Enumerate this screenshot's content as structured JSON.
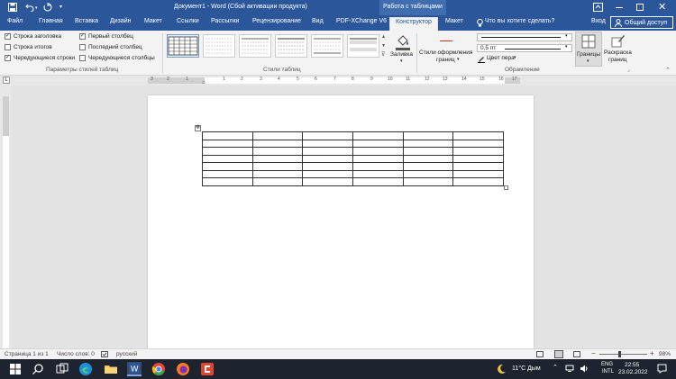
{
  "title_bar": {
    "document_title": "Документ1 - Word (Сбой активации продукта)",
    "context_title": "Работа с таблицами",
    "account": "Вход"
  },
  "ribbon_tabs": [
    {
      "label": "Файл"
    },
    {
      "label": "Главная"
    },
    {
      "label": "Вставка"
    },
    {
      "label": "Дизайн"
    },
    {
      "label": "Макет"
    },
    {
      "label": "Ссылки"
    },
    {
      "label": "Рассылки"
    },
    {
      "label": "Рецензирование"
    },
    {
      "label": "Вид"
    },
    {
      "label": "PDF-XChange V6"
    },
    {
      "label": "Конструктор"
    },
    {
      "label": "Макет"
    }
  ],
  "tell_me": "Что вы хотите сделать?",
  "share": "Общий доступ",
  "table_style_options": {
    "group_label": "Параметры стилей таблиц",
    "options": [
      {
        "label": "Строка заголовка",
        "checked": true
      },
      {
        "label": "Строка итогов",
        "checked": false
      },
      {
        "label": "Чередующиеся строки",
        "checked": true
      },
      {
        "label": "Первый столбец",
        "checked": true
      },
      {
        "label": "Последний столбец",
        "checked": false
      },
      {
        "label": "Чередующиеся столбцы",
        "checked": false
      }
    ]
  },
  "table_styles": {
    "group_label": "Стили таблиц"
  },
  "shading": {
    "label": "Заливка"
  },
  "borders_group": {
    "group_label": "Обрамление",
    "border_styles_line1": "Стили оформления",
    "border_styles_line2": "границ",
    "weight": "0,5 пт",
    "pen_color": "Цвет пера",
    "borders_label": "Границы",
    "painter_line1": "Раскраска",
    "painter_line2": "границ"
  },
  "ruler_numbers": [
    "3",
    "2",
    "1",
    "1",
    "2",
    "3",
    "4",
    "5",
    "6",
    "7",
    "8",
    "9",
    "10",
    "11",
    "12",
    "13",
    "14",
    "15",
    "16",
    "17"
  ],
  "document_table": {
    "rows": 7,
    "cols": 6
  },
  "status_bar": {
    "page": "Страница 1 из 1",
    "words": "Число слов: 0",
    "language": "русский",
    "zoom": "98%"
  },
  "taskbar": {
    "weather": "11°C Дым",
    "lang_line1": "ENG",
    "lang_line2": "INTL",
    "time": "22:55",
    "date": "23.02.2022"
  },
  "colors": {
    "word_blue": "#2b579a",
    "ribbon_bg": "#f3f3f3",
    "taskbar_bg": "#1d2430"
  }
}
